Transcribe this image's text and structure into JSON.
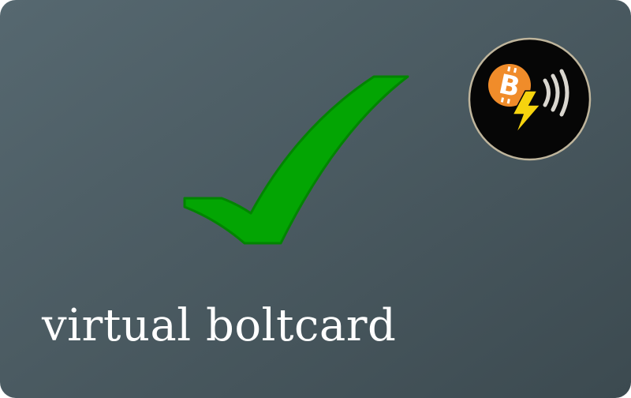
{
  "card": {
    "title": "virtual boltcard",
    "background_start": "#566870",
    "background_end": "#3c4a50"
  },
  "status_icon": {
    "name": "checkmark-icon",
    "color": "#03a503",
    "outline": "#028402"
  },
  "logo": {
    "name": "bitcoin-lightning-nfc-logo",
    "circle_color": "#060606",
    "ring_color": "#bfb59c",
    "bitcoin_color": "#f08c2a",
    "bolt_color": "#f6d30e",
    "waves_color": "#d9d6cf"
  }
}
